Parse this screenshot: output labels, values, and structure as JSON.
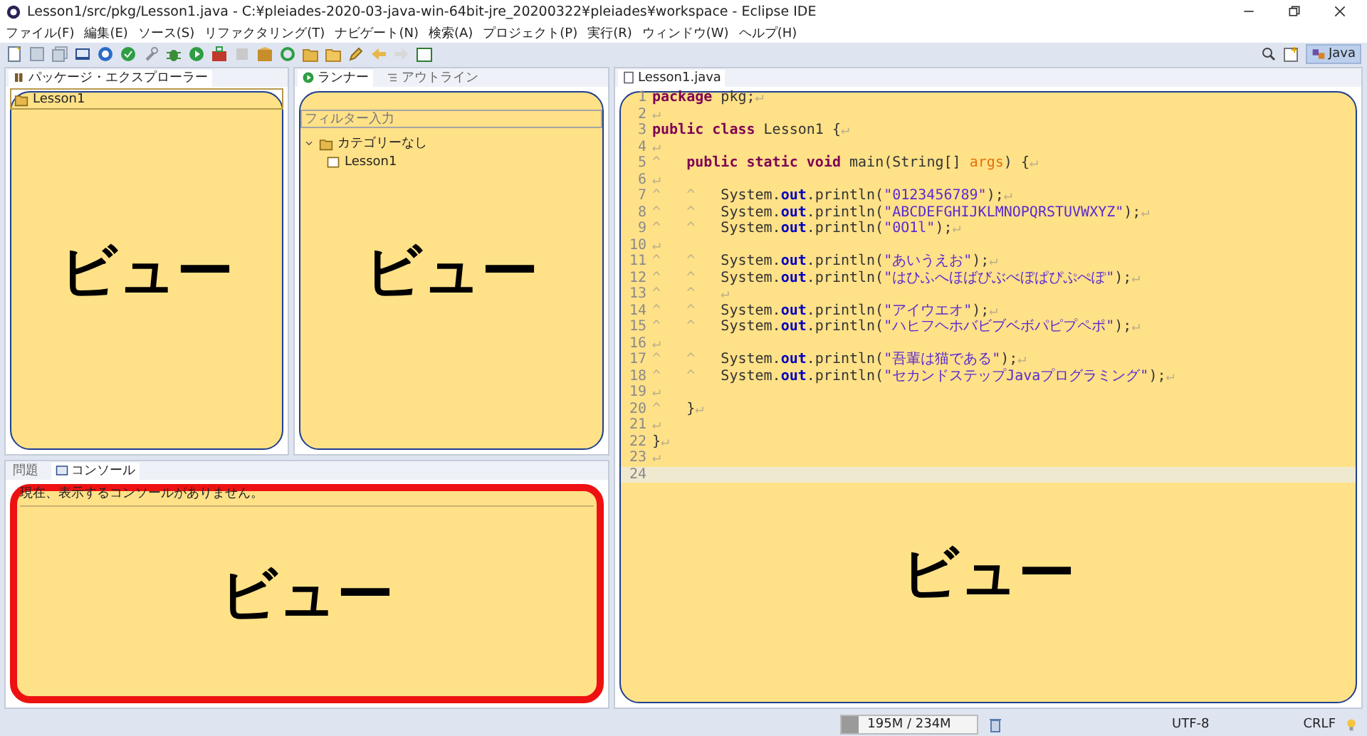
{
  "window": {
    "title": "Lesson1/src/pkg/Lesson1.java - C:¥pleiades-2020-03-java-win-64bit-jre_20200322¥pleiades¥workspace - Eclipse IDE"
  },
  "menu": [
    "ファイル(F)",
    "編集(E)",
    "ソース(S)",
    "リファクタリング(T)",
    "ナビゲート(N)",
    "検索(A)",
    "プロジェクト(P)",
    "実行(R)",
    "ウィンドウ(W)",
    "ヘルプ(H)"
  ],
  "perspective": {
    "label": "Java",
    "selected": true
  },
  "package_explorer": {
    "tabs": [
      {
        "label": "パッケージ・エクスプローラー",
        "selected": true
      }
    ],
    "tree": [
      {
        "label": "Lesson1",
        "selected": true
      }
    ],
    "overlay": {
      "label": "ビュー",
      "highlighted": false
    }
  },
  "junit": {
    "tabs": [
      {
        "label": "ランナー",
        "selected": true
      },
      {
        "label": "アウトライン",
        "selected": false
      }
    ],
    "filter": {
      "placeholder": "フィルター入力"
    },
    "tree": [
      {
        "label": "カテゴリーなし",
        "expanded": true,
        "children": [
          {
            "label": "Lesson1"
          }
        ]
      }
    ],
    "overlay": {
      "label": "ビュー",
      "highlighted": false
    }
  },
  "console": {
    "tabs": [
      {
        "label": "問題",
        "selected": false
      },
      {
        "label": "コンソール",
        "selected": true
      }
    ],
    "message": "現在、表示するコンソールがありません。",
    "overlay": {
      "label": "ビュー",
      "highlighted": true
    }
  },
  "editor": {
    "tabs": [
      {
        "label": "Lesson1.java",
        "selected": true
      }
    ],
    "overlay": {
      "label": "ビュー",
      "highlighted": false
    },
    "lines": [
      {
        "number": "1",
        "current": false,
        "segments": [
          {
            "kind": "kw",
            "text": "package"
          },
          {
            "kind": "plain",
            "text": " pkg;"
          },
          {
            "kind": "ws",
            "text": "↵"
          }
        ]
      },
      {
        "number": "2",
        "current": false,
        "segments": [
          {
            "kind": "ws",
            "text": "↵"
          }
        ]
      },
      {
        "number": "3",
        "current": false,
        "segments": [
          {
            "kind": "kw",
            "text": "public "
          },
          {
            "kind": "kw",
            "text": "class"
          },
          {
            "kind": "plain",
            "text": " Lesson1 {"
          },
          {
            "kind": "ws",
            "text": "↵"
          }
        ]
      },
      {
        "number": "4",
        "current": false,
        "segments": [
          {
            "kind": "ws",
            "text": "↵"
          }
        ]
      },
      {
        "number": "5",
        "current": false,
        "segments": [
          {
            "kind": "ws",
            "text": "^   "
          },
          {
            "kind": "kw",
            "text": "public "
          },
          {
            "kind": "kw",
            "text": "static "
          },
          {
            "kind": "kw",
            "text": "void"
          },
          {
            "kind": "plain",
            "text": " main(String[] "
          },
          {
            "kind": "param",
            "text": "args"
          },
          {
            "kind": "plain",
            "text": ") {"
          },
          {
            "kind": "ws",
            "text": "↵"
          }
        ]
      },
      {
        "number": "6",
        "current": false,
        "segments": [
          {
            "kind": "ws",
            "text": "↵"
          }
        ]
      },
      {
        "number": "7",
        "current": false,
        "segments": [
          {
            "kind": "ws",
            "text": "^   ^   "
          },
          {
            "kind": "plain",
            "text": "System."
          },
          {
            "kind": "field",
            "text": "out"
          },
          {
            "kind": "plain",
            "text": ".println("
          },
          {
            "kind": "str",
            "text": "\"0123456789\""
          },
          {
            "kind": "plain",
            "text": ");"
          },
          {
            "kind": "ws",
            "text": "↵"
          }
        ]
      },
      {
        "number": "8",
        "current": false,
        "segments": [
          {
            "kind": "ws",
            "text": "^   ^   "
          },
          {
            "kind": "plain",
            "text": "System."
          },
          {
            "kind": "field",
            "text": "out"
          },
          {
            "kind": "plain",
            "text": ".println("
          },
          {
            "kind": "str",
            "text": "\"ABCDEFGHIJKLMNOPQRSTUVWXYZ\""
          },
          {
            "kind": "plain",
            "text": ");"
          },
          {
            "kind": "ws",
            "text": "↵"
          }
        ]
      },
      {
        "number": "9",
        "current": false,
        "segments": [
          {
            "kind": "ws",
            "text": "^   ^   "
          },
          {
            "kind": "plain",
            "text": "System."
          },
          {
            "kind": "field",
            "text": "out"
          },
          {
            "kind": "plain",
            "text": ".println("
          },
          {
            "kind": "str",
            "text": "\"0O1l\""
          },
          {
            "kind": "plain",
            "text": ");"
          },
          {
            "kind": "ws",
            "text": "↵"
          }
        ]
      },
      {
        "number": "10",
        "current": false,
        "segments": [
          {
            "kind": "ws",
            "text": "↵"
          }
        ]
      },
      {
        "number": "11",
        "current": false,
        "segments": [
          {
            "kind": "ws",
            "text": "^   ^   "
          },
          {
            "kind": "plain",
            "text": "System."
          },
          {
            "kind": "field",
            "text": "out"
          },
          {
            "kind": "plain",
            "text": ".println("
          },
          {
            "kind": "str",
            "text": "\"あいうえお\""
          },
          {
            "kind": "plain",
            "text": ");"
          },
          {
            "kind": "ws",
            "text": "↵"
          }
        ]
      },
      {
        "number": "12",
        "current": false,
        "segments": [
          {
            "kind": "ws",
            "text": "^   ^   "
          },
          {
            "kind": "plain",
            "text": "System."
          },
          {
            "kind": "field",
            "text": "out"
          },
          {
            "kind": "plain",
            "text": ".println("
          },
          {
            "kind": "str",
            "text": "\"はひふへほばびぶべぼぱぴぷぺぽ\""
          },
          {
            "kind": "plain",
            "text": ");"
          },
          {
            "kind": "ws",
            "text": "↵"
          }
        ]
      },
      {
        "number": "13",
        "current": false,
        "segments": [
          {
            "kind": "ws",
            "text": "^   ^   ↵"
          }
        ]
      },
      {
        "number": "14",
        "current": false,
        "segments": [
          {
            "kind": "ws",
            "text": "^   ^   "
          },
          {
            "kind": "plain",
            "text": "System."
          },
          {
            "kind": "field",
            "text": "out"
          },
          {
            "kind": "plain",
            "text": ".println("
          },
          {
            "kind": "str",
            "text": "\"アイウエオ\""
          },
          {
            "kind": "plain",
            "text": ");"
          },
          {
            "kind": "ws",
            "text": "↵"
          }
        ]
      },
      {
        "number": "15",
        "current": false,
        "segments": [
          {
            "kind": "ws",
            "text": "^   ^   "
          },
          {
            "kind": "plain",
            "text": "System."
          },
          {
            "kind": "field",
            "text": "out"
          },
          {
            "kind": "plain",
            "text": ".println("
          },
          {
            "kind": "str",
            "text": "\"ハヒフヘホバビブベボパピプペポ\""
          },
          {
            "kind": "plain",
            "text": ");"
          },
          {
            "kind": "ws",
            "text": "↵"
          }
        ]
      },
      {
        "number": "16",
        "current": false,
        "segments": [
          {
            "kind": "ws",
            "text": "↵"
          }
        ]
      },
      {
        "number": "17",
        "current": false,
        "segments": [
          {
            "kind": "ws",
            "text": "^   ^   "
          },
          {
            "kind": "plain",
            "text": "System."
          },
          {
            "kind": "field",
            "text": "out"
          },
          {
            "kind": "plain",
            "text": ".println("
          },
          {
            "kind": "str",
            "text": "\"吾輩は猫である\""
          },
          {
            "kind": "plain",
            "text": ");"
          },
          {
            "kind": "ws",
            "text": "↵"
          }
        ]
      },
      {
        "number": "18",
        "current": false,
        "segments": [
          {
            "kind": "ws",
            "text": "^   ^   "
          },
          {
            "kind": "plain",
            "text": "System."
          },
          {
            "kind": "field",
            "text": "out"
          },
          {
            "kind": "plain",
            "text": ".println("
          },
          {
            "kind": "str",
            "text": "\"セカンドステップJavaプログラミング\""
          },
          {
            "kind": "plain",
            "text": ");"
          },
          {
            "kind": "ws",
            "text": "↵"
          }
        ]
      },
      {
        "number": "19",
        "current": false,
        "segments": [
          {
            "kind": "ws",
            "text": "↵"
          }
        ]
      },
      {
        "number": "20",
        "current": false,
        "segments": [
          {
            "kind": "ws",
            "text": "^   "
          },
          {
            "kind": "plain",
            "text": "}"
          },
          {
            "kind": "ws",
            "text": "↵"
          }
        ]
      },
      {
        "number": "21",
        "current": false,
        "segments": [
          {
            "kind": "ws",
            "text": "↵"
          }
        ]
      },
      {
        "number": "22",
        "current": false,
        "segments": [
          {
            "kind": "plain",
            "text": "}"
          },
          {
            "kind": "ws",
            "text": "↵"
          }
        ]
      },
      {
        "number": "23",
        "current": false,
        "segments": [
          {
            "kind": "ws",
            "text": "↵"
          }
        ]
      },
      {
        "number": "24",
        "current": true
      }
    ]
  },
  "status_bar": {
    "memory": {
      "text": "195M / 234M",
      "level": 0.13
    },
    "encoding": "UTF-8",
    "line_delimiter": "CRLF"
  }
}
